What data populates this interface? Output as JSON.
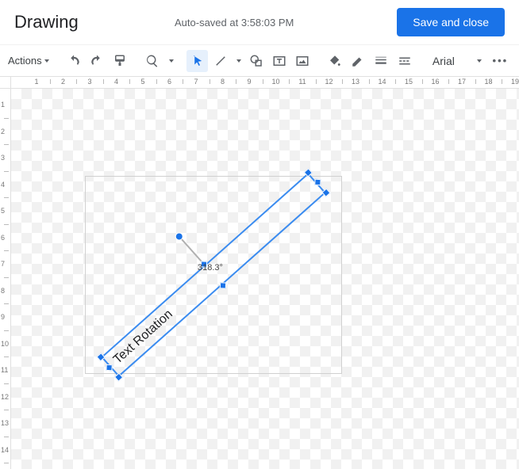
{
  "header": {
    "title": "Drawing",
    "autosave": "Auto-saved at 3:58:03 PM",
    "save_button": "Save and close"
  },
  "toolbar": {
    "actions_label": "Actions",
    "font": "Arial"
  },
  "ruler": {
    "h_labels": [
      "1",
      "2",
      "3",
      "4",
      "5",
      "6",
      "7",
      "8",
      "9",
      "10",
      "11",
      "12",
      "13",
      "14",
      "15",
      "16",
      "17",
      "18",
      "19"
    ],
    "v_labels": [
      "1",
      "2",
      "3",
      "4",
      "5",
      "6",
      "7",
      "8",
      "9",
      "10",
      "11",
      "12",
      "13",
      "14"
    ]
  },
  "canvas": {
    "shape_text": "Text Rotation",
    "rotation_angle_display": "318.3°",
    "rotation_deg": 318.3
  }
}
